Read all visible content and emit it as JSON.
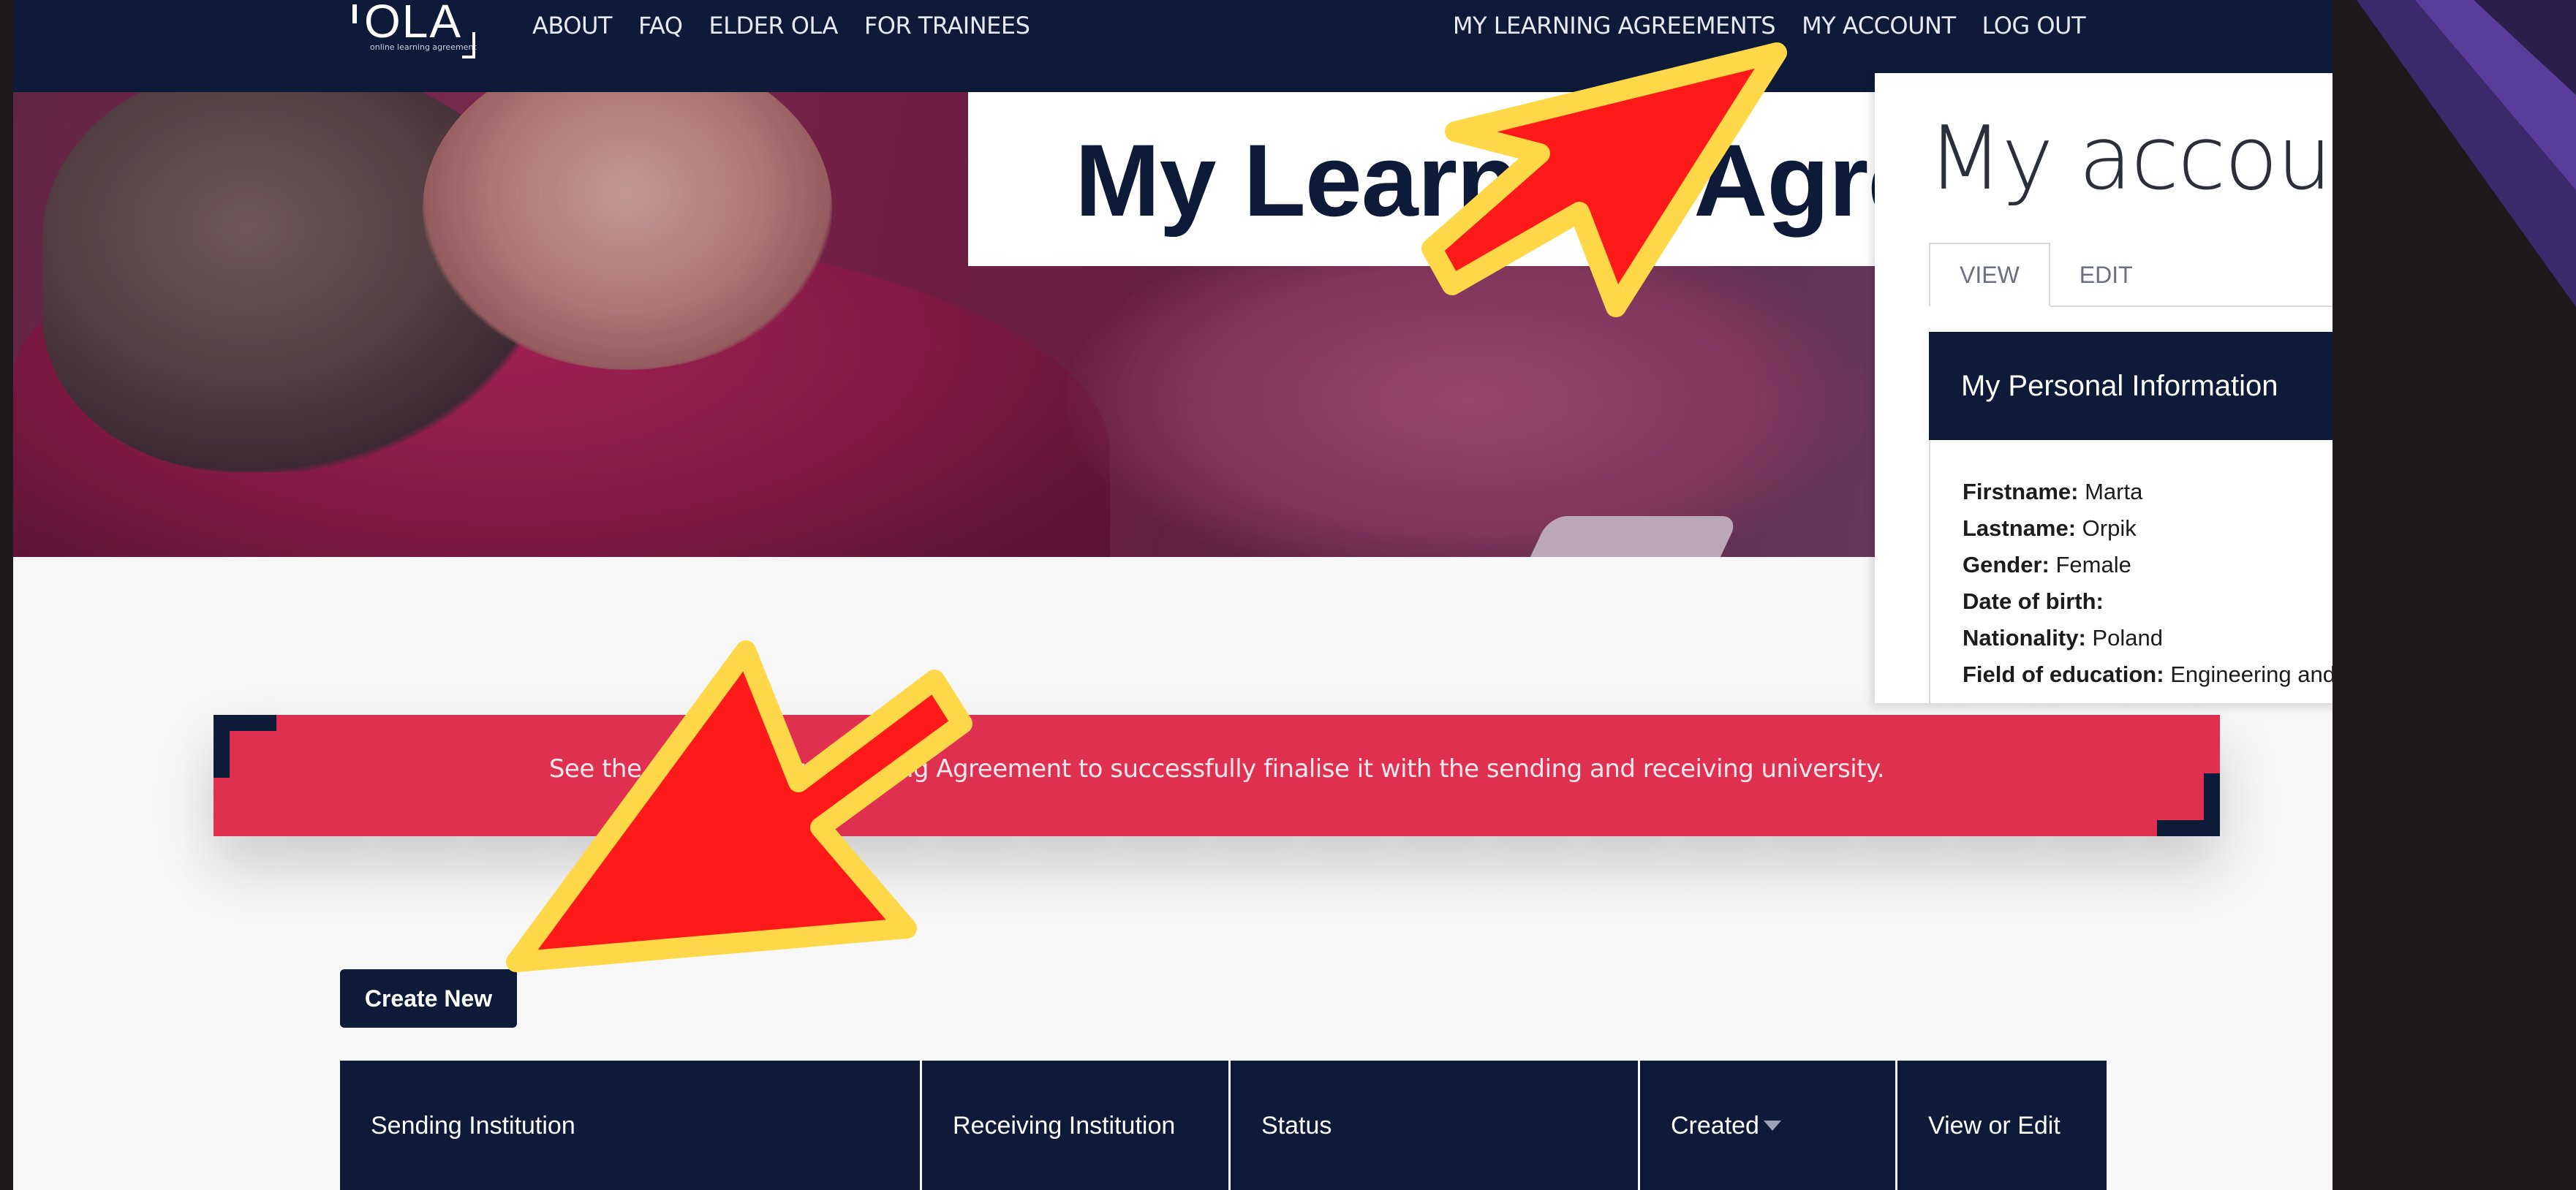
{
  "site": {
    "logo": {
      "text": "OLA",
      "tagline": "online learning agreement"
    },
    "nav_left": [
      "ABOUT",
      "FAQ",
      "ELDER OLA",
      "FOR TRAINEES"
    ],
    "nav_right": [
      "MY LEARNING AGREEMENTS",
      "MY ACCOUNT",
      "LOG OUT"
    ],
    "page_title": "My Learning Agreements",
    "alert": "See the status of your Learning Agreement to successfully finalise it with the sending and receiving university.",
    "create_button": "Create New",
    "table_headers": [
      "Sending Institution",
      "Receiving Institution",
      "Status",
      "Created",
      "View or Edit"
    ]
  },
  "account": {
    "title": "My account",
    "tabs": [
      "VIEW",
      "EDIT"
    ],
    "active_tab": "VIEW",
    "section_title": "My Personal Information",
    "fields": [
      {
        "label": "Firstname:",
        "value": "Marta"
      },
      {
        "label": "Lastname:",
        "value": "Orpik"
      },
      {
        "label": "Gender:",
        "value": "Female"
      },
      {
        "label": "Date of birth:",
        "value": ""
      },
      {
        "label": "Nationality:",
        "value": "Poland"
      },
      {
        "label": "Field of education:",
        "value": "Engineering and engineering trades"
      }
    ]
  },
  "colors": {
    "navy": "#0d1b38",
    "alert_red": "#e0304f",
    "arrow_red": "#ff1a1a",
    "arrow_outline": "#ffd84a"
  }
}
